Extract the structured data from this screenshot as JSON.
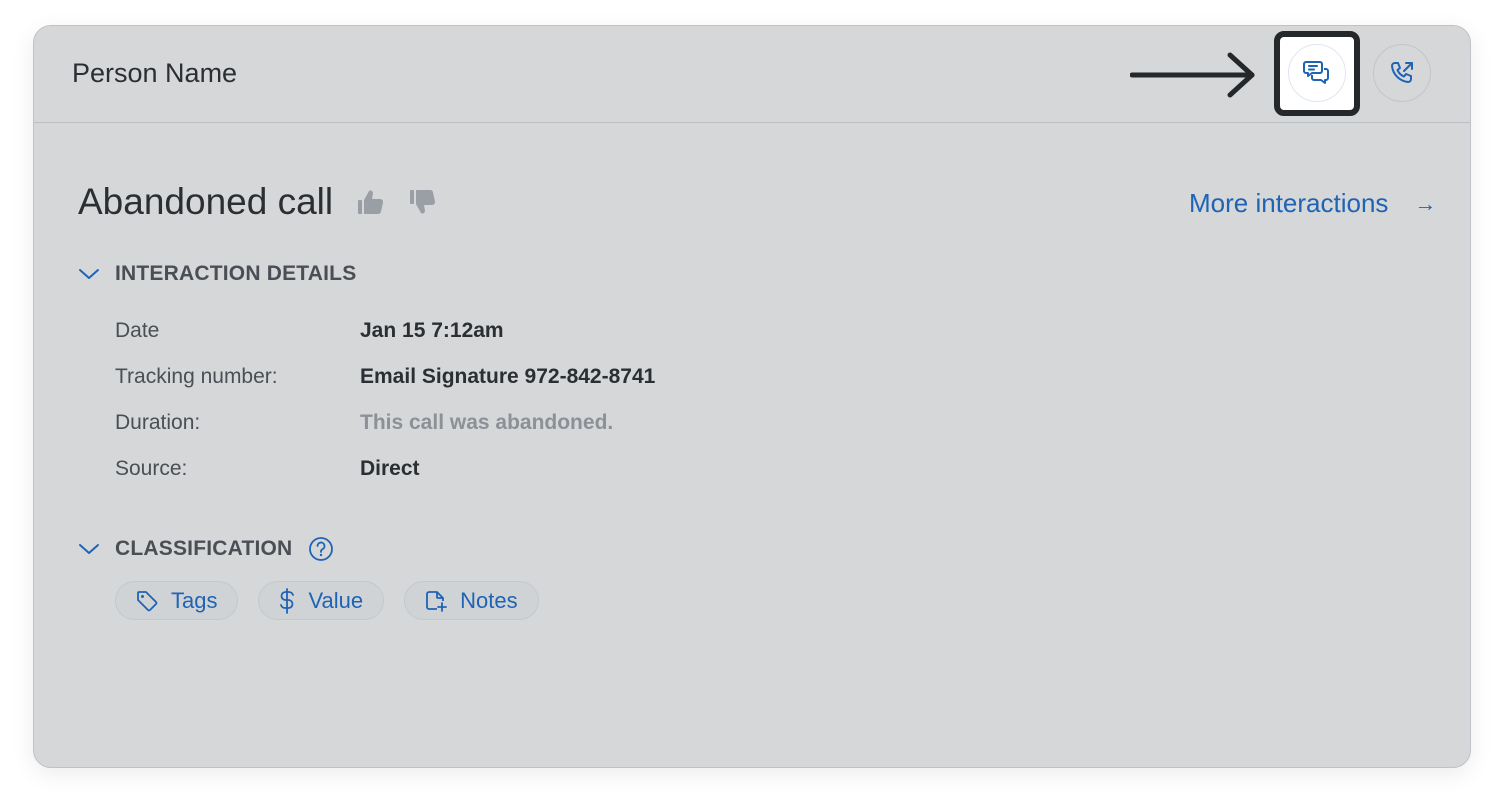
{
  "header": {
    "person_name": "Person Name",
    "actions": [
      {
        "name": "conversation",
        "icon": "chat-bubbles-icon",
        "highlighted": true
      },
      {
        "name": "call-out",
        "icon": "phone-outgoing-icon",
        "highlighted": false
      }
    ]
  },
  "interaction": {
    "title": "Abandoned call",
    "thumbs_up_icon": "thumbs-up-icon",
    "thumbs_down_icon": "thumbs-down-icon",
    "more_link": "More interactions",
    "more_arrow": "→"
  },
  "details_section": {
    "label": "INTERACTION DETAILS",
    "rows": [
      {
        "key": "Date",
        "value": "Jan 15 7:12am",
        "muted": false
      },
      {
        "key": "Tracking number:",
        "value": "Email Signature 972-842-8741",
        "muted": false
      },
      {
        "key": "Duration:",
        "value": "This call was abandoned.",
        "muted": true
      },
      {
        "key": "Source:",
        "value": "Direct",
        "muted": false
      }
    ]
  },
  "classification_section": {
    "label": "CLASSIFICATION",
    "help_icon": "question-circle-icon",
    "chips": [
      {
        "label": "Tags",
        "icon": "tag-icon"
      },
      {
        "label": "Value",
        "icon": "dollar-icon"
      },
      {
        "label": "Notes",
        "icon": "note-add-icon"
      }
    ]
  },
  "colors": {
    "card_bg": "#d5d7d8",
    "accent": "#1f63b5",
    "text": "#2b2f33",
    "muted": "#8c9198",
    "annotation": "#25282b"
  }
}
